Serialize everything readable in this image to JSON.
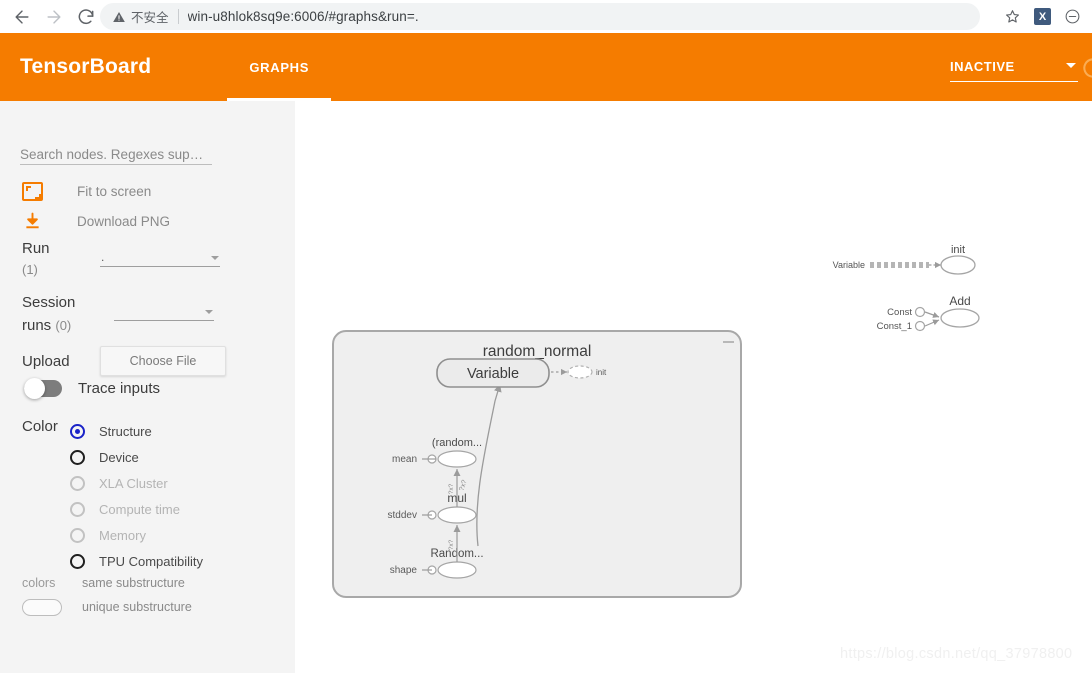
{
  "browser": {
    "back_icon": "arrow-left-icon",
    "forward_icon": "arrow-right-icon",
    "reload_icon": "reload-icon",
    "security_icon": "warning-triangle-icon",
    "security_label": "不安全",
    "url": "win-u8hlok8sq9e:6006/#graphs&run=.",
    "bookmark_icon": "star-icon",
    "extension_label": "X",
    "profile_icon": "minus-circle-icon"
  },
  "header": {
    "logo": "TensorBoard",
    "tabs": [
      {
        "label": "GRAPHS",
        "active": true
      }
    ],
    "status": "INACTIVE",
    "caret_icon": "chevron-down-icon",
    "refresh_icon": "refresh-icon",
    "accent_color": "#f57c00"
  },
  "sidebar": {
    "search_placeholder": "Search nodes. Regexes sup…",
    "search_value": "",
    "fit_to_screen": "Fit to screen",
    "fit_icon": "fit-to-screen-icon",
    "download_png": "Download PNG",
    "download_icon": "download-icon",
    "run_label": "Run",
    "run_count": "(1)",
    "run_value": ".",
    "session_label": "Session",
    "session_sub_label": "runs",
    "session_count": "(0)",
    "session_value": "",
    "upload_label": "Upload",
    "choose_file": "Choose File",
    "trace_inputs_label": "Trace inputs",
    "trace_inputs_on": false,
    "color_label": "Color",
    "color_options": [
      {
        "label": "Structure",
        "selected": true,
        "disabled": false
      },
      {
        "label": "Device",
        "selected": false,
        "disabled": false
      },
      {
        "label": "XLA Cluster",
        "selected": false,
        "disabled": true
      },
      {
        "label": "Compute time",
        "selected": false,
        "disabled": true
      },
      {
        "label": "Memory",
        "selected": false,
        "disabled": true
      },
      {
        "label": "TPU Compatibility",
        "selected": false,
        "disabled": false
      }
    ],
    "colors_legend_label": "colors",
    "legend_same": "same substructure",
    "legend_unique": "unique substructure"
  },
  "graph": {
    "variable_node": "Variable",
    "init_node": "init",
    "cluster_title": "random_normal",
    "cluster_collapse_icon": "minus-icon",
    "nodes": [
      {
        "label": "(random...",
        "port": "mean"
      },
      {
        "label": "mul",
        "port": "stddev"
      },
      {
        "label": "Random...",
        "port": "shape"
      }
    ],
    "edge_labels": [
      "?x?",
      "?x?"
    ],
    "legend": {
      "variable": "Variable",
      "init": "init",
      "const": "Const",
      "const_1": "Const_1",
      "add": "Add"
    }
  },
  "watermark": "https://blog.csdn.net/qq_37978800"
}
